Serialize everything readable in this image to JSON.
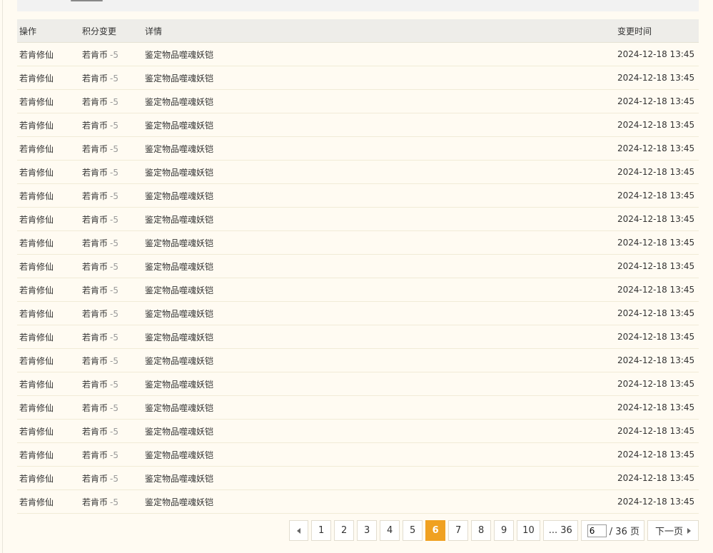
{
  "table": {
    "headers": {
      "action": "操作",
      "change": "积分变更",
      "detail": "详情",
      "time": "变更时间"
    },
    "rows": [
      {
        "action": "若肯修仙",
        "currency": "若肯币",
        "delta": "-5",
        "detail": "鉴定物品噬魂妖铠",
        "time": "2024-12-18 13:45"
      },
      {
        "action": "若肯修仙",
        "currency": "若肯币",
        "delta": "-5",
        "detail": "鉴定物品噬魂妖铠",
        "time": "2024-12-18 13:45"
      },
      {
        "action": "若肯修仙",
        "currency": "若肯币",
        "delta": "-5",
        "detail": "鉴定物品噬魂妖铠",
        "time": "2024-12-18 13:45"
      },
      {
        "action": "若肯修仙",
        "currency": "若肯币",
        "delta": "-5",
        "detail": "鉴定物品噬魂妖铠",
        "time": "2024-12-18 13:45"
      },
      {
        "action": "若肯修仙",
        "currency": "若肯币",
        "delta": "-5",
        "detail": "鉴定物品噬魂妖铠",
        "time": "2024-12-18 13:45"
      },
      {
        "action": "若肯修仙",
        "currency": "若肯币",
        "delta": "-5",
        "detail": "鉴定物品噬魂妖铠",
        "time": "2024-12-18 13:45"
      },
      {
        "action": "若肯修仙",
        "currency": "若肯币",
        "delta": "-5",
        "detail": "鉴定物品噬魂妖铠",
        "time": "2024-12-18 13:45"
      },
      {
        "action": "若肯修仙",
        "currency": "若肯币",
        "delta": "-5",
        "detail": "鉴定物品噬魂妖铠",
        "time": "2024-12-18 13:45"
      },
      {
        "action": "若肯修仙",
        "currency": "若肯币",
        "delta": "-5",
        "detail": "鉴定物品噬魂妖铠",
        "time": "2024-12-18 13:45"
      },
      {
        "action": "若肯修仙",
        "currency": "若肯币",
        "delta": "-5",
        "detail": "鉴定物品噬魂妖铠",
        "time": "2024-12-18 13:45"
      },
      {
        "action": "若肯修仙",
        "currency": "若肯币",
        "delta": "-5",
        "detail": "鉴定物品噬魂妖铠",
        "time": "2024-12-18 13:45"
      },
      {
        "action": "若肯修仙",
        "currency": "若肯币",
        "delta": "-5",
        "detail": "鉴定物品噬魂妖铠",
        "time": "2024-12-18 13:45"
      },
      {
        "action": "若肯修仙",
        "currency": "若肯币",
        "delta": "-5",
        "detail": "鉴定物品噬魂妖铠",
        "time": "2024-12-18 13:45"
      },
      {
        "action": "若肯修仙",
        "currency": "若肯币",
        "delta": "-5",
        "detail": "鉴定物品噬魂妖铠",
        "time": "2024-12-18 13:45"
      },
      {
        "action": "若肯修仙",
        "currency": "若肯币",
        "delta": "-5",
        "detail": "鉴定物品噬魂妖铠",
        "time": "2024-12-18 13:45"
      },
      {
        "action": "若肯修仙",
        "currency": "若肯币",
        "delta": "-5",
        "detail": "鉴定物品噬魂妖铠",
        "time": "2024-12-18 13:45"
      },
      {
        "action": "若肯修仙",
        "currency": "若肯币",
        "delta": "-5",
        "detail": "鉴定物品噬魂妖铠",
        "time": "2024-12-18 13:45"
      },
      {
        "action": "若肯修仙",
        "currency": "若肯币",
        "delta": "-5",
        "detail": "鉴定物品噬魂妖铠",
        "time": "2024-12-18 13:45"
      },
      {
        "action": "若肯修仙",
        "currency": "若肯币",
        "delta": "-5",
        "detail": "鉴定物品噬魂妖铠",
        "time": "2024-12-18 13:45"
      },
      {
        "action": "若肯修仙",
        "currency": "若肯币",
        "delta": "-5",
        "detail": "鉴定物品噬魂妖铠",
        "time": "2024-12-18 13:45"
      }
    ]
  },
  "pagination": {
    "prev_icon": "caret-left-icon",
    "pages": [
      "1",
      "2",
      "3",
      "4",
      "5",
      "6",
      "7",
      "8",
      "9",
      "10"
    ],
    "current": "6",
    "ellipsis_last": "... 36",
    "jump_value": "6",
    "total_text": "/ 36 页",
    "next_label": "下一页",
    "next_icon": "caret-right-icon",
    "active_color": "#f0a121"
  }
}
